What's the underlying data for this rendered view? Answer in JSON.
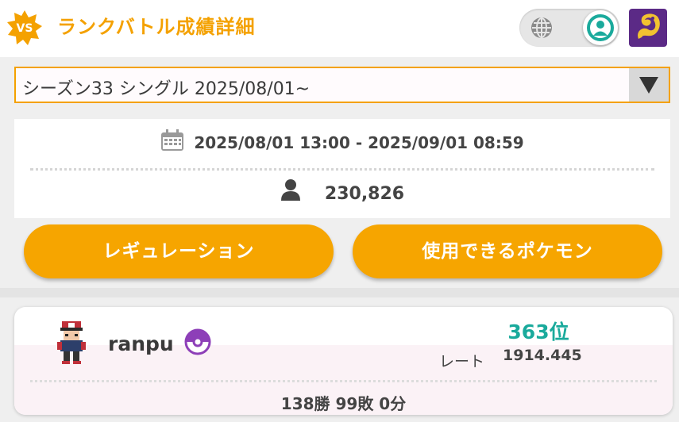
{
  "header": {
    "badge": "VS",
    "title": "ランクバトル成績詳細"
  },
  "season": {
    "selected": "シーズン33 シングル 2025/08/01~"
  },
  "period": {
    "range": "2025/08/01 13:00 - 2025/09/01 08:59"
  },
  "participants": {
    "count": "230,826"
  },
  "buttons": {
    "regulation": "レギュレーション",
    "usable_pokemon": "使用できるポケモン"
  },
  "player": {
    "name": "ranpu",
    "rank": "363位",
    "rate_label": "レート",
    "rate_value": "1914.445",
    "record": "138勝 99敗 0分"
  },
  "colors": {
    "accent": "#f4a100",
    "rank": "#1aaa9c",
    "app_icon_bg": "#5b2a86"
  }
}
